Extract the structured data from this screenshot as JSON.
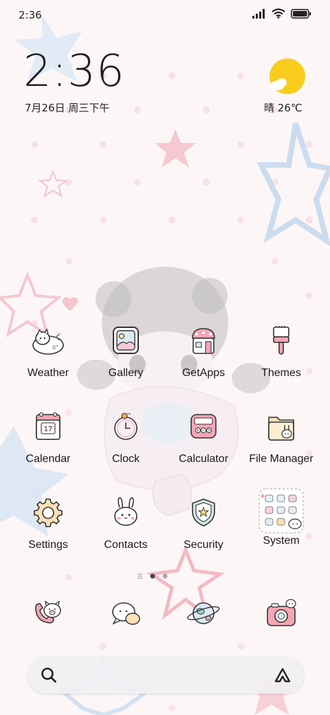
{
  "status_bar": {
    "time": "2:36",
    "icons": [
      "signal-icon",
      "wifi-icon",
      "battery-icon"
    ]
  },
  "clock_widget": {
    "time": "2:36",
    "date": "7月26日 周三下午"
  },
  "weather_widget": {
    "condition": "晴",
    "temperature": "26℃",
    "icon": "sun-cloud-icon"
  },
  "apps": [
    {
      "label": "Weather",
      "icon": "weather-cat-icon"
    },
    {
      "label": "Gallery",
      "icon": "gallery-icon"
    },
    {
      "label": "GetApps",
      "icon": "store-icon"
    },
    {
      "label": "Themes",
      "icon": "paintbrush-icon"
    },
    {
      "label": "Calendar",
      "icon": "calendar-icon",
      "badge": "17"
    },
    {
      "label": "Clock",
      "icon": "clock-icon"
    },
    {
      "label": "Calculator",
      "icon": "calculator-icon"
    },
    {
      "label": "File Manager",
      "icon": "folder-icon"
    },
    {
      "label": "Settings",
      "icon": "gear-icon"
    },
    {
      "label": "Contacts",
      "icon": "bunny-icon"
    },
    {
      "label": "Security",
      "icon": "shield-icon"
    },
    {
      "label": "System",
      "icon": "folder-grid-icon"
    }
  ],
  "page_indicator": {
    "pages": 2,
    "current": 1
  },
  "dock": [
    {
      "name": "phone",
      "icon": "phone-pig-icon"
    },
    {
      "name": "messages",
      "icon": "chat-bubble-icon"
    },
    {
      "name": "browser",
      "icon": "planet-icon"
    },
    {
      "name": "camera",
      "icon": "camera-icon"
    }
  ],
  "search_bar": {
    "left_icon": "search-icon",
    "right_icon": "assistant-icon"
  },
  "colors": {
    "accent_pink": "#f2a5b4",
    "sun_yellow": "#f9cd1d",
    "wallpaper_bg": "#fdf7f8"
  }
}
